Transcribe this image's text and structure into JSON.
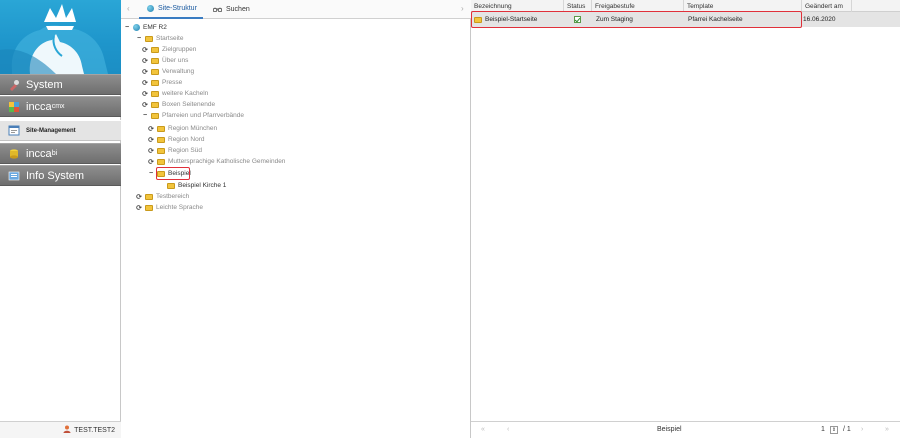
{
  "sidebar": {
    "items": [
      {
        "label": "System",
        "sup": ""
      },
      {
        "label": "incca",
        "sup": "cmx"
      },
      {
        "label": "Site-Management",
        "sup": ""
      },
      {
        "label": "incca",
        "sup": "bi"
      },
      {
        "label": "Info System",
        "sup": ""
      }
    ],
    "user": "TEST.TEST2"
  },
  "tree_panel": {
    "tabs": [
      {
        "label": "Site-Struktur"
      },
      {
        "label": "Suchen"
      }
    ],
    "nodes": [
      {
        "label": "EMF R2"
      },
      {
        "label": "Startseite"
      },
      {
        "label": "Zielgruppen"
      },
      {
        "label": "Über uns"
      },
      {
        "label": "Verwaltung"
      },
      {
        "label": "Presse"
      },
      {
        "label": "weitere Kacheln"
      },
      {
        "label": "Boxen Seitenende"
      },
      {
        "label": "Pfarreien und Pfarrverbände"
      },
      {
        "label": "Region München"
      },
      {
        "label": "Region Nord"
      },
      {
        "label": "Region Süd"
      },
      {
        "label": "Muttersprachige Katholische Gemeinden"
      },
      {
        "label": "Beispiel"
      },
      {
        "label": "Beispiel Kirche 1"
      },
      {
        "label": "Testbereich"
      },
      {
        "label": "Leichte Sprache"
      }
    ]
  },
  "grid": {
    "columns": [
      "Bezeichnung",
      "Status",
      "Freigabestufe",
      "Template",
      "Geändert am"
    ],
    "rows": [
      {
        "bezeichnung": "Beispiel-Startseite",
        "freigabestufe": "Zum Staging",
        "template": "Pfarrei Kachelseite",
        "geaendert": "16.06.2020"
      }
    ],
    "footer": {
      "first": "«",
      "prev": "‹",
      "title": "Beispiel",
      "page": "1",
      "total": "/ 1",
      "next": "›",
      "last": "»"
    }
  },
  "colors": {
    "highlight": "#e0303a",
    "accent": "#3a7cc2",
    "sidebar_button": "#7a7a7a",
    "logo_bg": "#1e95cb"
  }
}
